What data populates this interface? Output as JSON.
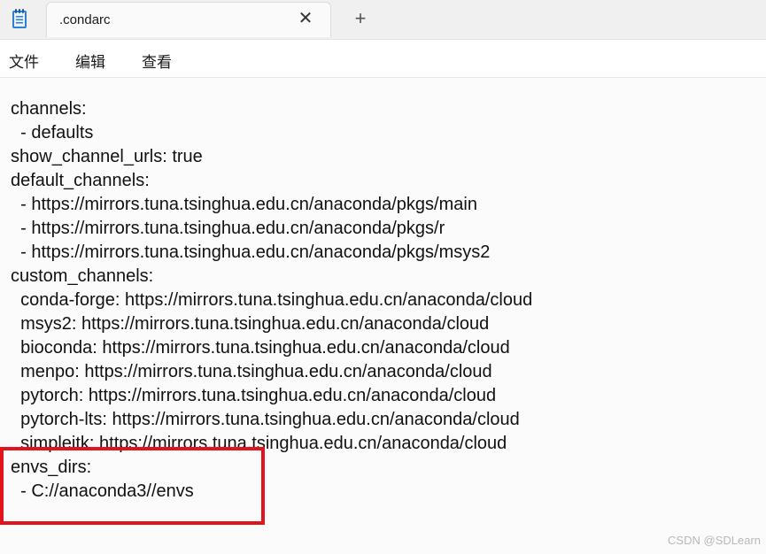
{
  "tab": {
    "title": ".condarc",
    "close_glyph": "✕",
    "new_tab_glyph": "+"
  },
  "icons": {
    "app": "notepad-icon",
    "close": "close-icon",
    "new_tab": "plus-icon"
  },
  "menu": {
    "items": [
      "文件",
      "编辑",
      "查看"
    ]
  },
  "editor": {
    "lines": [
      "channels:",
      "  - defaults",
      "show_channel_urls: true",
      "default_channels:",
      "  - https://mirrors.tuna.tsinghua.edu.cn/anaconda/pkgs/main",
      "  - https://mirrors.tuna.tsinghua.edu.cn/anaconda/pkgs/r",
      "  - https://mirrors.tuna.tsinghua.edu.cn/anaconda/pkgs/msys2",
      "custom_channels:",
      "  conda-forge: https://mirrors.tuna.tsinghua.edu.cn/anaconda/cloud",
      "  msys2: https://mirrors.tuna.tsinghua.edu.cn/anaconda/cloud",
      "  bioconda: https://mirrors.tuna.tsinghua.edu.cn/anaconda/cloud",
      "  menpo: https://mirrors.tuna.tsinghua.edu.cn/anaconda/cloud",
      "  pytorch: https://mirrors.tuna.tsinghua.edu.cn/anaconda/cloud",
      "  pytorch-lts: https://mirrors.tuna.tsinghua.edu.cn/anaconda/cloud",
      "  simpleitk: https://mirrors.tuna.tsinghua.edu.cn/anaconda/cloud",
      "envs_dirs:",
      "  - C://anaconda3//envs"
    ]
  },
  "annotation": {
    "highlight_color": "#e2141b"
  },
  "watermark": "CSDN @SDLearn"
}
